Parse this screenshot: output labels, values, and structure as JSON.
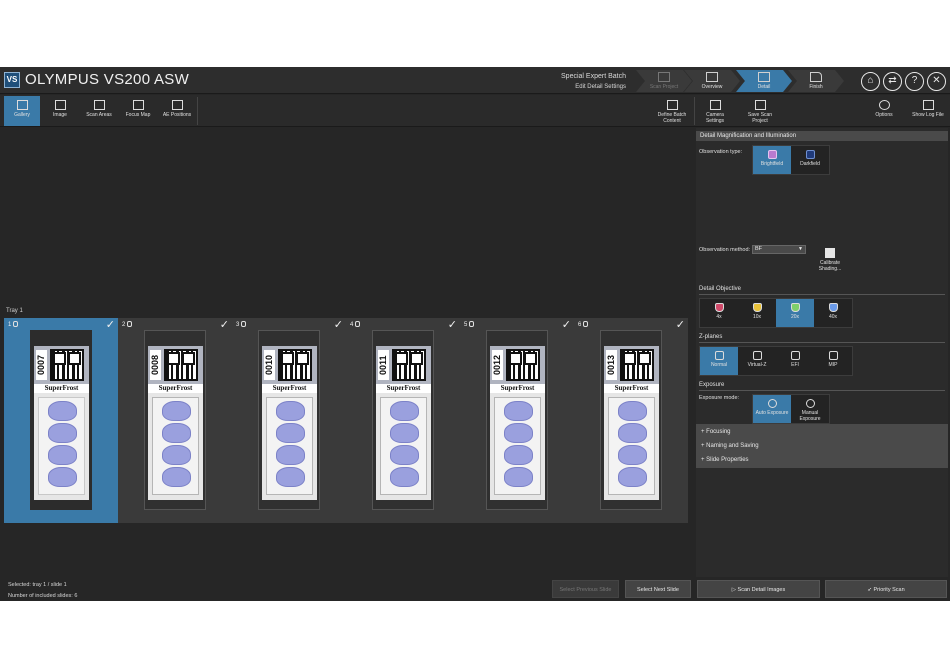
{
  "app": {
    "logo": "VS",
    "title": "OLYMPUS VS200 ASW"
  },
  "mode": {
    "name": "Special Expert Batch",
    "sub": "Edit Detail Settings"
  },
  "wizard": [
    {
      "label": "Scan Project",
      "icon": "scan-project-icon",
      "state": "disabled"
    },
    {
      "label": "Overview",
      "icon": "overview-icon",
      "state": "done"
    },
    {
      "label": "Detail",
      "icon": "detail-icon",
      "state": "active"
    },
    {
      "label": "Finish",
      "icon": "finish-flag-icon",
      "state": "pending"
    }
  ],
  "window_icons": [
    {
      "name": "home-icon",
      "glyph": "⌂"
    },
    {
      "name": "switch-icon",
      "glyph": "⇄"
    },
    {
      "name": "help-icon",
      "glyph": "?"
    },
    {
      "name": "close-icon",
      "glyph": "✕"
    }
  ],
  "toolbar": {
    "left": [
      {
        "label": "Gallery",
        "icon": "gallery-icon",
        "active": true
      },
      {
        "label": "Image",
        "icon": "image-icon",
        "active": false
      },
      {
        "label": "Scan Areas",
        "icon": "scan-areas-icon",
        "active": false
      },
      {
        "label": "Focus Map",
        "icon": "focus-map-icon",
        "active": false
      },
      {
        "label": "AE Positions",
        "icon": "ae-positions-icon",
        "active": false
      }
    ],
    "define_batch": "Define Batch Content",
    "camera_settings": "Camera Settings",
    "save_scan_project": "Save Scan Project",
    "options": "Options",
    "show_log_file": "Show Log File"
  },
  "tray": {
    "label": "Tray 1",
    "slots": [
      {
        "index": "1",
        "slide_id": "0007",
        "selected": true,
        "checked": true
      },
      {
        "index": "2",
        "slide_id": "0008",
        "selected": false,
        "checked": true
      },
      {
        "index": "3",
        "slide_id": "0010",
        "selected": false,
        "checked": true
      },
      {
        "index": "4",
        "slide_id": "0011",
        "selected": false,
        "checked": true
      },
      {
        "index": "5",
        "slide_id": "0012",
        "selected": false,
        "checked": true
      },
      {
        "index": "6",
        "slide_id": "0013",
        "selected": false,
        "checked": true
      }
    ],
    "brand_text": "SuperFrost",
    "check_glyph": "✓"
  },
  "status": {
    "selected": "Selected: tray 1 / slide 1",
    "included": "Number of included slides: 6"
  },
  "nav": {
    "prev": "Select Previous Slide",
    "next": "Select Next Slide"
  },
  "panel": {
    "header": "Detail Magnification and Illumination",
    "observation_type_label": "Observation type:",
    "observation_types": [
      {
        "label": "Brightfield",
        "active": true
      },
      {
        "label": "Darkfield",
        "active": false
      }
    ],
    "observation_method_label": "Observation method:",
    "observation_method_value": "BF",
    "calibrate_label": "Calibrate Shading...",
    "detail_objective_label": "Detail Objective",
    "objectives": [
      {
        "label": "4x",
        "active": false,
        "color": "#d04a6a"
      },
      {
        "label": "10x",
        "active": false,
        "color": "#e8c23a"
      },
      {
        "label": "20x",
        "active": true,
        "color": "#7fcf6a"
      },
      {
        "label": "40x",
        "active": false,
        "color": "#6a9ae8"
      }
    ],
    "zplanes_label": "Z-planes",
    "zplanes": [
      {
        "label": "Normal",
        "active": true
      },
      {
        "label": "Virtual-Z",
        "active": false
      },
      {
        "label": "EFI",
        "active": false
      },
      {
        "label": "MIP",
        "active": false
      }
    ],
    "exposure_label": "Exposure",
    "exposure_mode_label": "Exposure mode:",
    "exposure_modes": [
      {
        "label": "Auto Exposure",
        "active": true
      },
      {
        "label": "Manual Exposure",
        "active": false
      }
    ],
    "collapsed": [
      "Focusing",
      "Naming and Saving",
      "Slide Properties"
    ]
  },
  "actions": {
    "scan_detail": "Scan Detail Images",
    "priority_scan": "Priority Scan"
  },
  "colors": {
    "accent": "#3a7aa8",
    "background": "#262626",
    "panel": "#2b2b2b"
  }
}
